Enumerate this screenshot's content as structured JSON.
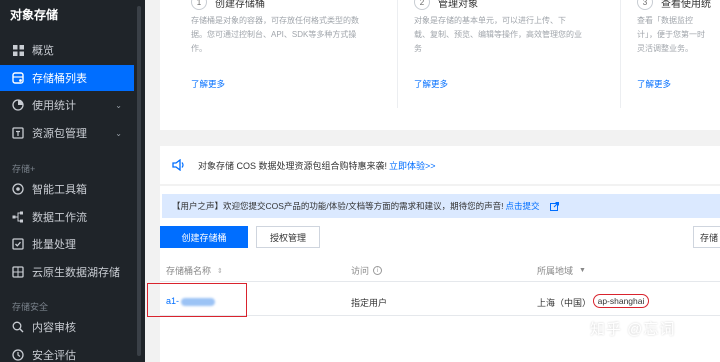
{
  "sidebar": {
    "brand": "对象存储",
    "items": [
      {
        "label": "概览",
        "icon": "overview-grid-icon"
      },
      {
        "label": "存储桶列表",
        "icon": "bucket-list-icon",
        "active": true
      },
      {
        "label": "使用统计",
        "icon": "usage-pie-icon",
        "expandable": true
      },
      {
        "label": "资源包管理",
        "icon": "package-icon",
        "expandable": true
      }
    ],
    "group_storage_plus": "存储+",
    "plus_items": [
      {
        "label": "智能工具箱",
        "icon": "toolbox-icon"
      },
      {
        "label": "数据工作流",
        "icon": "workflow-icon"
      },
      {
        "label": "批量处理",
        "icon": "batch-check-icon"
      },
      {
        "label": "云原生数据湖存储",
        "icon": "datalake-icon"
      }
    ],
    "group_security": "存储安全",
    "security_items": [
      {
        "label": "内容审核",
        "icon": "content-audit-icon"
      },
      {
        "label": "安全评估",
        "icon": "security-shield-icon"
      }
    ]
  },
  "cards": [
    {
      "step": "1",
      "title": "创建存储桶",
      "desc_line1": "存储桶是对象的容器，可存放任何格式类型的数",
      "desc_line2": "据。您可通过控制台、API、SDK等多种方式操",
      "desc_line3": "作。",
      "link": "了解更多"
    },
    {
      "step": "2",
      "title": "管理对象",
      "desc_line1": "对象是存储的基本单元，可以进行上传、下",
      "desc_line2": "载、复制、预览、编辑等操作，高效管理您的业",
      "desc_line3": "务",
      "link": "了解更多"
    },
    {
      "step": "3",
      "title": "查看使用统",
      "desc_line1": "查看「数据监控",
      "desc_line2": "计」，便于您第一时",
      "desc_line3": "灵活调整业务。",
      "link": "了解更多"
    }
  ],
  "notice": {
    "text": "对象存储 COS 数据处理资源包组合购特惠来袭!",
    "link": "立即体验>>"
  },
  "feedback": {
    "text": "【用户之声】欢迎您提交COS产品的功能/体验/文档等方面的需求和建议，期待您的声音!",
    "link": "点击提交"
  },
  "toolbar": {
    "create_label": "创建存储桶",
    "auth_label": "授权管理",
    "right_label": "存储"
  },
  "table": {
    "headers": {
      "name": "存储桶名称",
      "access": "访问",
      "region": "所属地域"
    },
    "rows": [
      {
        "name_prefix": "a1-",
        "access": "指定用户",
        "region": "上海（中国）",
        "region_code": "ap-shanghai"
      }
    ]
  },
  "watermark": "知乎 @忘词",
  "colors": {
    "accent": "#006eff",
    "sidebar_bg": "#1f2429",
    "highlight_red": "#d9232d"
  }
}
